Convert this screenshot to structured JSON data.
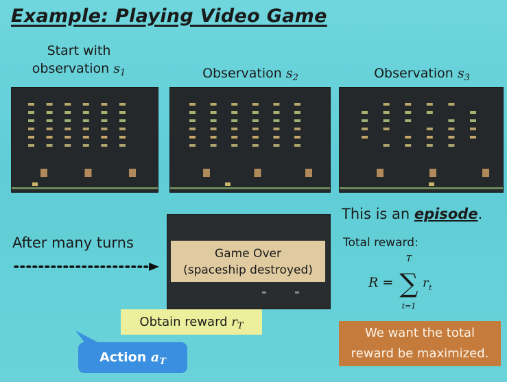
{
  "title": "Example: Playing Video Game",
  "panels": [
    {
      "caption_line1": "Start with",
      "caption_line2": "observation ",
      "symbol": "s",
      "sub": "1"
    },
    {
      "caption_line1": "Observation ",
      "symbol": "s",
      "sub": "2"
    },
    {
      "caption_line1": "Observation ",
      "symbol": "s",
      "sub": "3"
    }
  ],
  "after_label": "After many turns",
  "game_over": {
    "line1": "Game Over",
    "line2": "(spaceship destroyed)"
  },
  "reward_tag": {
    "text": "Obtain reward ",
    "symbol": "r",
    "sub": "T"
  },
  "action": {
    "text": "Action ",
    "symbol": "a",
    "sub": "T"
  },
  "episode": {
    "prefix": "This is an ",
    "word": "episode",
    "suffix": "."
  },
  "total_reward_label": "Total reward:",
  "formula": {
    "lhs": "R =",
    "sum_top": "T",
    "sum_bottom": "t=1",
    "term": "r",
    "term_sub": "t"
  },
  "goal_box": {
    "line1": "We want the total",
    "line2": "reward be maximized."
  },
  "colors": {
    "background": "#6ad3d9",
    "game_screen": "#25282b",
    "game_over_box": "#e0cba0",
    "reward_tag": "#ecef9c",
    "action_bubble": "#3a8fe0",
    "goal_box": "#c47b3c"
  }
}
